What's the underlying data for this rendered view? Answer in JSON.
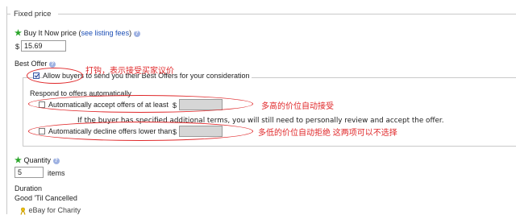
{
  "fixed_price": {
    "legend": "Fixed price",
    "buy_it_now": {
      "label": "Buy It Now price",
      "see_fees_open": "(",
      "see_fees_link": "see listing fees",
      "see_fees_close": ")",
      "currency": "$",
      "value": "15.69"
    },
    "best_offer": {
      "label": "Best Offer",
      "allow_label": "Allow buyers to send you their Best Offers for your consideration",
      "allow_checked": true,
      "respond_label": "Respond to offers automatically",
      "auto_accept_label": "Automatically accept offers of at least",
      "auto_accept_currency": "$",
      "auto_accept_value": "",
      "note": "If the buyer has specified additional terms, you will still need to personally review and accept the offer.",
      "auto_decline_label": "Automatically decline offers lower than",
      "auto_decline_currency": "$",
      "auto_decline_value": ""
    },
    "quantity": {
      "label": "Quantity",
      "value": "5",
      "unit": "items"
    },
    "duration": {
      "label": "Duration",
      "value": "Good 'Til Cancelled"
    },
    "charity": {
      "label": "eBay for Charity"
    }
  },
  "annotations": {
    "allow_note": "打钩，表示接受买家议价",
    "accept_note": "多高的价位自动接受",
    "decline_note": "多低的价位自动拒绝 这两项可以不选择"
  },
  "icons": {
    "help": "?",
    "required": "★"
  },
  "colors": {
    "link": "#1c4eb5",
    "required_star": "#2aa52a",
    "annotation": "#e0282a"
  }
}
